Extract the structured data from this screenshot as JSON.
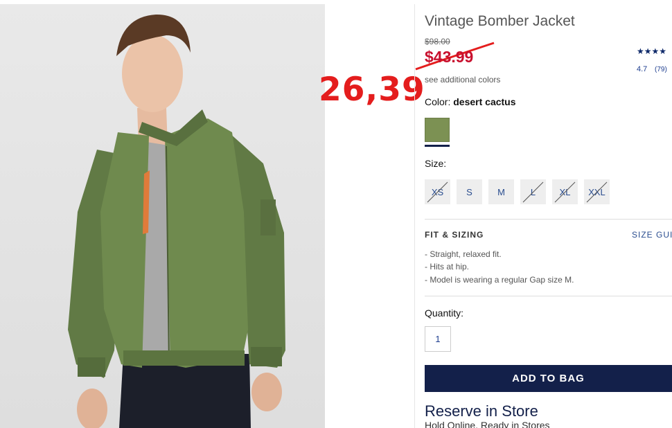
{
  "product": {
    "title": "Vintage Bomber Jacket",
    "original_price": "$98.00",
    "sale_price": "$43.99",
    "see_colors_link": "see additional colors"
  },
  "annotation": {
    "handwritten_price": "26,39",
    "color": "#e41d1d"
  },
  "rating": {
    "stars": "★★★★",
    "value": "4.7",
    "count": "(79)",
    "star_color": "#0f2a6a"
  },
  "color_selector": {
    "label": "Color:",
    "selected": "desert cactus",
    "swatch_color": "#7c9153"
  },
  "size_selector": {
    "label": "Size:",
    "options": [
      {
        "label": "XS",
        "available": false
      },
      {
        "label": "S",
        "available": true
      },
      {
        "label": "M",
        "available": true
      },
      {
        "label": "L",
        "available": false
      },
      {
        "label": "XL",
        "available": false
      },
      {
        "label": "XXL",
        "available": false
      }
    ]
  },
  "fit_sizing": {
    "title": "FIT & SIZING",
    "size_guide_link": "SIZE GUIDE",
    "items": [
      "- Straight, relaxed fit.",
      "- Hits at hip.",
      "- Model is wearing a regular Gap size M."
    ]
  },
  "quantity": {
    "label": "Quantity:",
    "value": "1"
  },
  "add_to_bag": {
    "label": "ADD TO BAG",
    "color": "#13204a"
  },
  "reserve": {
    "title": "Reserve in Store",
    "subtitle": "Hold Online, Ready in Stores"
  }
}
